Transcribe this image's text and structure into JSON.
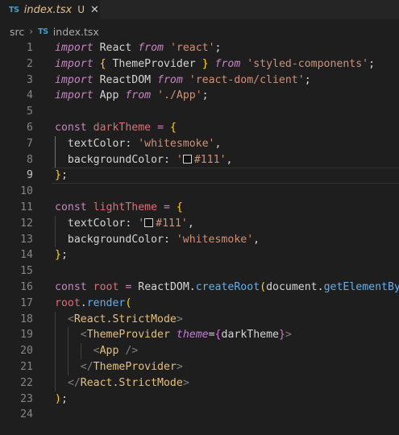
{
  "tab": {
    "icon_label": "TS",
    "title": "index.tsx",
    "status": "U",
    "close_glyph": "✕"
  },
  "breadcrumb": {
    "folder": "src",
    "separator": "›",
    "icon_label": "TS",
    "file": "index.tsx"
  },
  "colors": {
    "editor_bg": "#1e1e1e",
    "keyword": "#c586c0",
    "string": "#ce9178",
    "variable": "#e06c75",
    "function": "#61afef",
    "jsx_tag": "#e5c07b",
    "color_swatch": "#111111"
  },
  "lines": [
    {
      "n": "1",
      "current": false,
      "guides": [],
      "tokens": [
        {
          "t": "import",
          "c": "kw-i"
        },
        {
          "t": " React ",
          "c": "op"
        },
        {
          "t": "from",
          "c": "kw-i"
        },
        {
          "t": " ",
          "c": "op"
        },
        {
          "t": "'react'",
          "c": "str"
        },
        {
          "t": ";",
          "c": "op"
        }
      ]
    },
    {
      "n": "2",
      "current": false,
      "guides": [],
      "tokens": [
        {
          "t": "import",
          "c": "kw-i"
        },
        {
          "t": " ",
          "c": "op"
        },
        {
          "t": "{",
          "c": "br1"
        },
        {
          "t": " ThemeProvider ",
          "c": "op"
        },
        {
          "t": "}",
          "c": "br1"
        },
        {
          "t": " ",
          "c": "op"
        },
        {
          "t": "from",
          "c": "kw-i"
        },
        {
          "t": " ",
          "c": "op"
        },
        {
          "t": "'styled-components'",
          "c": "str"
        },
        {
          "t": ";",
          "c": "op"
        }
      ]
    },
    {
      "n": "3",
      "current": false,
      "guides": [],
      "tokens": [
        {
          "t": "import",
          "c": "kw-i"
        },
        {
          "t": " ReactDOM ",
          "c": "op"
        },
        {
          "t": "from",
          "c": "kw-i"
        },
        {
          "t": " ",
          "c": "op"
        },
        {
          "t": "'react-dom/client'",
          "c": "str"
        },
        {
          "t": ";",
          "c": "op"
        }
      ]
    },
    {
      "n": "4",
      "current": false,
      "guides": [],
      "tokens": [
        {
          "t": "import",
          "c": "kw-i"
        },
        {
          "t": " App ",
          "c": "op"
        },
        {
          "t": "from",
          "c": "kw-i"
        },
        {
          "t": " ",
          "c": "op"
        },
        {
          "t": "'./App'",
          "c": "str"
        },
        {
          "t": ";",
          "c": "op"
        }
      ]
    },
    {
      "n": "5",
      "current": false,
      "guides": [],
      "tokens": []
    },
    {
      "n": "6",
      "current": false,
      "guides": [],
      "tokens": [
        {
          "t": "const",
          "c": "kw-d"
        },
        {
          "t": " ",
          "c": "op"
        },
        {
          "t": "darkTheme",
          "c": "var"
        },
        {
          "t": " ",
          "c": "op"
        },
        {
          "t": "=",
          "c": "kw-d"
        },
        {
          "t": " ",
          "c": "op"
        },
        {
          "t": "{",
          "c": "br1"
        }
      ]
    },
    {
      "n": "7",
      "current": false,
      "guides": [
        "g1a"
      ],
      "tokens": [
        {
          "t": "  textColor: ",
          "c": "op"
        },
        {
          "t": "'whitesmoke'",
          "c": "str"
        },
        {
          "t": ",",
          "c": "op"
        }
      ]
    },
    {
      "n": "8",
      "current": false,
      "guides": [
        "g1a"
      ],
      "tokens": [
        {
          "t": "  backgroundColor: ",
          "c": "op"
        },
        {
          "t": "'",
          "c": "str"
        },
        {
          "t": "",
          "c": "swatch"
        },
        {
          "t": "#111'",
          "c": "str"
        },
        {
          "t": ",",
          "c": "op"
        }
      ]
    },
    {
      "n": "9",
      "current": true,
      "guides": [],
      "tokens": [
        {
          "t": "}",
          "c": "br1"
        },
        {
          "t": ";",
          "c": "op"
        }
      ]
    },
    {
      "n": "10",
      "current": false,
      "guides": [],
      "tokens": []
    },
    {
      "n": "11",
      "current": false,
      "guides": [],
      "tokens": [
        {
          "t": "const",
          "c": "kw-d"
        },
        {
          "t": " ",
          "c": "op"
        },
        {
          "t": "lightTheme",
          "c": "var"
        },
        {
          "t": " ",
          "c": "op"
        },
        {
          "t": "=",
          "c": "kw-d"
        },
        {
          "t": " ",
          "c": "op"
        },
        {
          "t": "{",
          "c": "br1"
        }
      ]
    },
    {
      "n": "12",
      "current": false,
      "guides": [
        "g1"
      ],
      "tokens": [
        {
          "t": "  textColor: ",
          "c": "op"
        },
        {
          "t": "'",
          "c": "str"
        },
        {
          "t": "",
          "c": "swatch"
        },
        {
          "t": "#111'",
          "c": "str"
        },
        {
          "t": ",",
          "c": "op"
        }
      ]
    },
    {
      "n": "13",
      "current": false,
      "guides": [
        "g1"
      ],
      "tokens": [
        {
          "t": "  backgroundColor: ",
          "c": "op"
        },
        {
          "t": "'whitesmoke'",
          "c": "str"
        },
        {
          "t": ",",
          "c": "op"
        }
      ]
    },
    {
      "n": "14",
      "current": false,
      "guides": [],
      "tokens": [
        {
          "t": "}",
          "c": "br1"
        },
        {
          "t": ";",
          "c": "op"
        }
      ]
    },
    {
      "n": "15",
      "current": false,
      "guides": [],
      "tokens": []
    },
    {
      "n": "16",
      "current": false,
      "guides": [],
      "tokens": [
        {
          "t": "const",
          "c": "kw-d"
        },
        {
          "t": " ",
          "c": "op"
        },
        {
          "t": "root",
          "c": "var"
        },
        {
          "t": " ",
          "c": "op"
        },
        {
          "t": "=",
          "c": "kw-d"
        },
        {
          "t": " ReactDOM.",
          "c": "op"
        },
        {
          "t": "createRoot",
          "c": "fn"
        },
        {
          "t": "(",
          "c": "br1"
        },
        {
          "t": "document.",
          "c": "op"
        },
        {
          "t": "getElementBy",
          "c": "fn"
        }
      ]
    },
    {
      "n": "17",
      "current": false,
      "guides": [],
      "tokens": [
        {
          "t": "root",
          "c": "var"
        },
        {
          "t": ".",
          "c": "op"
        },
        {
          "t": "render",
          "c": "fn"
        },
        {
          "t": "(",
          "c": "br1"
        }
      ]
    },
    {
      "n": "18",
      "current": false,
      "guides": [
        "g1"
      ],
      "tokens": [
        {
          "t": "  ",
          "c": "op"
        },
        {
          "t": "<",
          "c": "tagp"
        },
        {
          "t": "React.StrictMode",
          "c": "tag"
        },
        {
          "t": ">",
          "c": "tagp"
        }
      ]
    },
    {
      "n": "19",
      "current": false,
      "guides": [
        "g1",
        "g2"
      ],
      "tokens": [
        {
          "t": "    ",
          "c": "op"
        },
        {
          "t": "<",
          "c": "tagp"
        },
        {
          "t": "ThemeProvider",
          "c": "tag"
        },
        {
          "t": " ",
          "c": "op"
        },
        {
          "t": "theme",
          "c": "attr"
        },
        {
          "t": "=",
          "c": "op"
        },
        {
          "t": "{",
          "c": "br2"
        },
        {
          "t": "darkTheme",
          "c": "op"
        },
        {
          "t": "}",
          "c": "br2"
        },
        {
          "t": ">",
          "c": "tagp"
        }
      ]
    },
    {
      "n": "20",
      "current": false,
      "guides": [
        "g1",
        "g2",
        "g3"
      ],
      "tokens": [
        {
          "t": "      ",
          "c": "op"
        },
        {
          "t": "<",
          "c": "tagp"
        },
        {
          "t": "App",
          "c": "tag"
        },
        {
          "t": " />",
          "c": "tagp"
        }
      ]
    },
    {
      "n": "21",
      "current": false,
      "guides": [
        "g1",
        "g2"
      ],
      "tokens": [
        {
          "t": "    ",
          "c": "op"
        },
        {
          "t": "</",
          "c": "tagp"
        },
        {
          "t": "ThemeProvider",
          "c": "tag"
        },
        {
          "t": ">",
          "c": "tagp"
        }
      ]
    },
    {
      "n": "22",
      "current": false,
      "guides": [
        "g1"
      ],
      "tokens": [
        {
          "t": "  ",
          "c": "op"
        },
        {
          "t": "</",
          "c": "tagp"
        },
        {
          "t": "React.StrictMode",
          "c": "tag"
        },
        {
          "t": ">",
          "c": "tagp"
        }
      ]
    },
    {
      "n": "23",
      "current": false,
      "guides": [],
      "tokens": [
        {
          "t": ")",
          "c": "br1"
        },
        {
          "t": ";",
          "c": "op"
        }
      ]
    },
    {
      "n": "24",
      "current": false,
      "guides": [],
      "tokens": []
    }
  ]
}
